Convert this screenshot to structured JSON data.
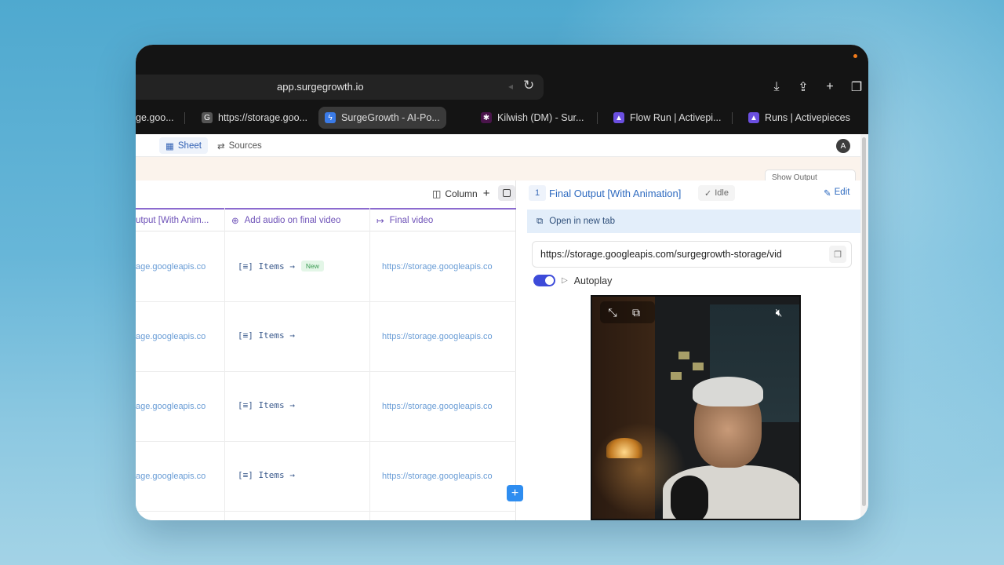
{
  "browser": {
    "url": "app.surgegrowth.io",
    "tabs": [
      {
        "label": "ge.goo..."
      },
      {
        "label": "https://storage.goo..."
      },
      {
        "label": "SurgeGrowth - AI-Po..."
      },
      {
        "label": "Kilwish (DM) - Sur..."
      },
      {
        "label": "Flow Run | Activepi..."
      },
      {
        "label": "Runs | Activepieces"
      }
    ]
  },
  "app": {
    "view_tabs": [
      {
        "label": "Sheet"
      },
      {
        "label": "Sources"
      }
    ],
    "avatar_letter": "A",
    "banner_button": "Show Output"
  },
  "sheet": {
    "column_button": "Column",
    "columns": [
      {
        "label": "utput [With Anim..."
      },
      {
        "label": "Add audio on final video"
      },
      {
        "label": "Final video"
      }
    ],
    "rows": [
      {
        "col1": "age.googleapis.co",
        "items": "[≡] Items →",
        "badge": "New",
        "col3": "https://storage.googleapis.co"
      },
      {
        "col1": "age.googleapis.co",
        "items": "[≡] Items →",
        "badge": "",
        "col3": "https://storage.googleapis.co"
      },
      {
        "col1": "age.googleapis.co",
        "items": "[≡] Items →",
        "badge": "",
        "col3": "https://storage.googleapis.co"
      },
      {
        "col1": "age.googleapis.co",
        "items": "[≡] Items →",
        "badge": "",
        "col3": "https://storage.googleapis.co"
      }
    ]
  },
  "detail": {
    "index": "1",
    "title": "Final Output [With Animation]",
    "status": "Idle",
    "edit_label": "Edit",
    "open_new_tab": "Open in new tab",
    "url_value": "https://storage.googleapis.com/surgegrowth-storage/vid",
    "autoplay_label": "Autoplay",
    "autoplay_on": true
  },
  "colors": {
    "accent_blue": "#2f6bc0",
    "purple_header": "#6e52b8",
    "toggle_on": "#3d4bd9",
    "add_button": "#2e8df0"
  }
}
